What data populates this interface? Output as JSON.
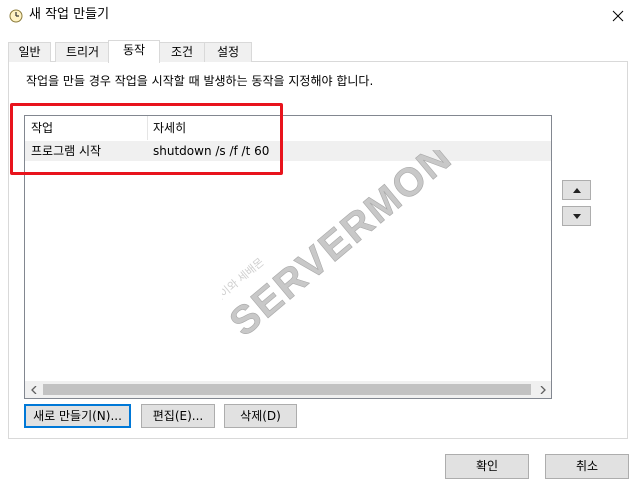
{
  "window": {
    "title": "새 작업 만들기",
    "icon": "clock-icon"
  },
  "tabs": [
    {
      "label": "일반"
    },
    {
      "label": "트리거"
    },
    {
      "label": "동작",
      "selected": true
    },
    {
      "label": "조건"
    },
    {
      "label": "설정"
    }
  ],
  "actions_tab": {
    "instructions": "작업을 만들 경우 작업을 시작할 때 발생하는 동작을 지정해야 합니다.",
    "columns": [
      "작업",
      "자세히"
    ],
    "rows": [
      {
        "action": "프로그램 시작",
        "details": "shutdown /s /f /t 60"
      }
    ],
    "buttons": {
      "new": "새로 만들기(N)...",
      "edit": "편집(E)...",
      "delete": "삭제(D)"
    }
  },
  "footer": {
    "ok": "확인",
    "cancel": "취소"
  },
  "watermark": {
    "brand": "SERVERMON",
    "sub": "조은이와 세배몬"
  },
  "colors": {
    "highlight": "#e8131c",
    "accent": "#0078d7",
    "watermark_green": "#b5d99c"
  }
}
